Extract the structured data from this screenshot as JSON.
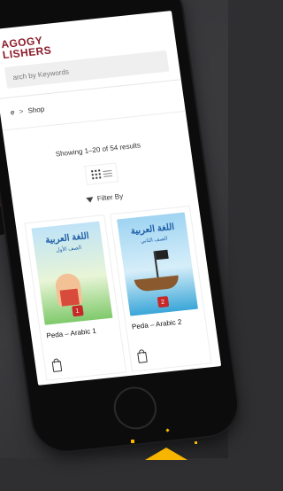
{
  "logo": {
    "line1": "AGOGY",
    "line2": "LISHERS"
  },
  "search": {
    "placeholder": "arch by Keywords"
  },
  "breadcrumb": {
    "home": "e",
    "separator": ">",
    "current": "Shop"
  },
  "results": {
    "text": "Showing 1–20 of 54 results"
  },
  "filter": {
    "label": "Filter By"
  },
  "products": [
    {
      "name": "Peda – Arabic 1",
      "cover_title": "اللغة العربية",
      "cover_sub": "الصف الأول",
      "badge": "1"
    },
    {
      "name": "Peda – Arabic 2",
      "cover_title": "اللغة العربية",
      "cover_sub": "الصف الثاني",
      "badge": "2"
    }
  ],
  "colors": {
    "brand": "#8c1c2a",
    "accent": "#f7b500"
  }
}
